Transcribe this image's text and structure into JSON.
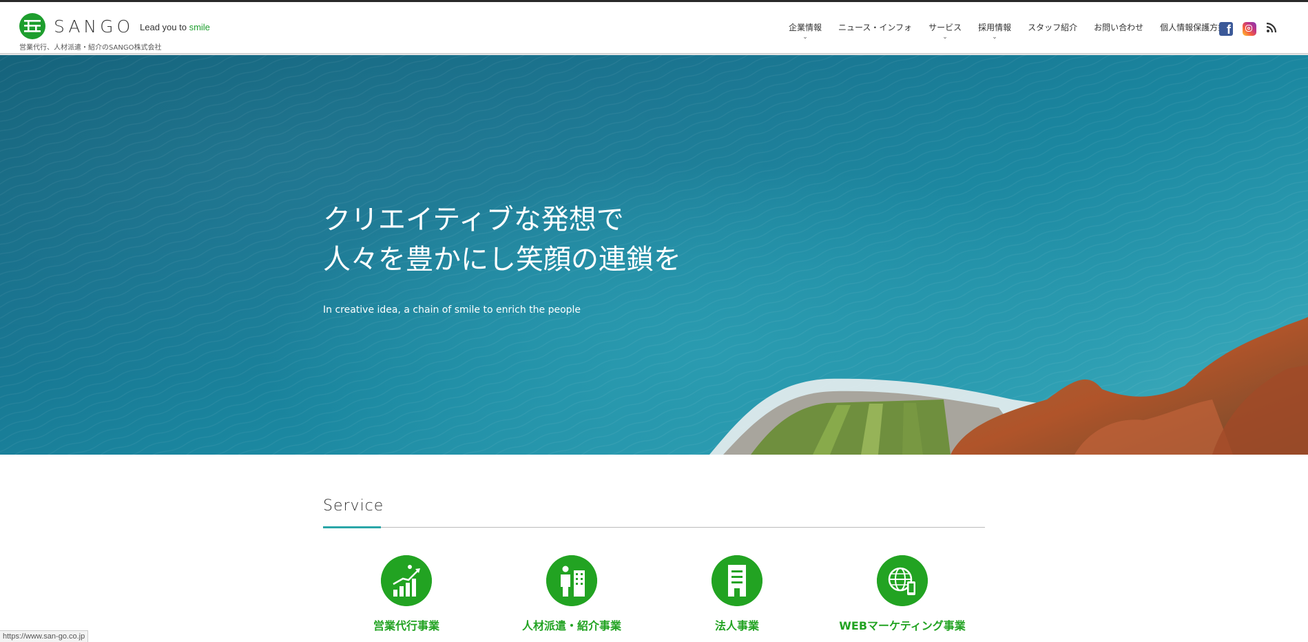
{
  "header": {
    "logo_text": "SANGO",
    "tagline_prefix": "Lead you to ",
    "tagline_accent": "smile",
    "logo_sub": "営業代行、人材派遣・紹介のSANGO株式会社",
    "brand_color": "#1e9e2e"
  },
  "nav": {
    "items": [
      {
        "label": "企業情報",
        "dropdown": true
      },
      {
        "label": "ニュース・インフォ",
        "dropdown": false
      },
      {
        "label": "サービス",
        "dropdown": true
      },
      {
        "label": "採用情報",
        "dropdown": true
      },
      {
        "label": "スタッフ紹介",
        "dropdown": false
      },
      {
        "label": "お問い合わせ",
        "dropdown": false
      },
      {
        "label": "個人情報保護方針",
        "dropdown": false
      }
    ],
    "social": [
      "facebook-icon",
      "instagram-icon",
      "rss-icon"
    ]
  },
  "hero": {
    "title_line1": "クリエイティブな発想で",
    "title_line2": "人々を豊かにし笑顔の連鎖を",
    "subtitle": "In creative idea, a chain of smile to enrich the people"
  },
  "service": {
    "heading": "Service",
    "items": [
      {
        "label": "営業代行事業",
        "icon": "sales-growth-icon"
      },
      {
        "label": "人材派遣・紹介事業",
        "icon": "staffing-icon"
      },
      {
        "label": "法人事業",
        "icon": "corporate-icon"
      },
      {
        "label": "WEBマーケティング事業",
        "icon": "web-marketing-icon"
      }
    ],
    "accent_color": "#22a322"
  },
  "status_bar": {
    "url": "https://www.san-go.co.jp"
  }
}
